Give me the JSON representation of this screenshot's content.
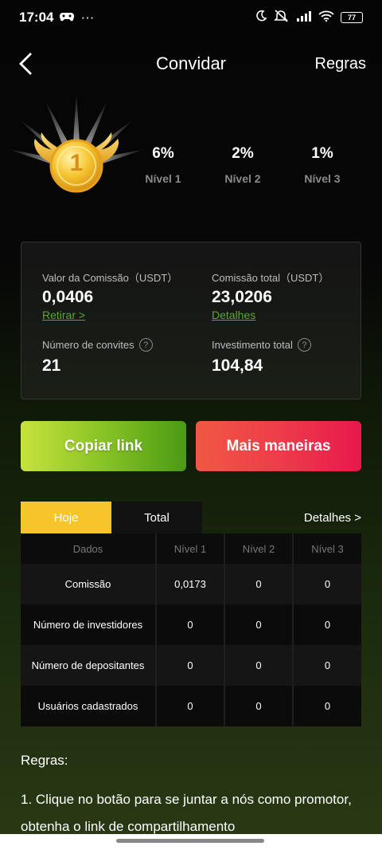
{
  "status_bar": {
    "time": "17:04",
    "dots": "···",
    "battery": "77"
  },
  "header": {
    "title": "Convidar",
    "rules_link": "Regras"
  },
  "medal": {
    "number": "1"
  },
  "levels": [
    {
      "pct": "6%",
      "name": "Nível 1"
    },
    {
      "pct": "2%",
      "name": "Nível 2"
    },
    {
      "pct": "1%",
      "name": "Nível 3"
    }
  ],
  "stats": {
    "commission_value": {
      "label": "Valor da Comissão（USDT）",
      "value": "0,0406",
      "link": "Retirar >"
    },
    "total_commission": {
      "label": "Comissão total（USDT）",
      "value": "23,0206",
      "link": "Detalhes"
    },
    "invites": {
      "label": "Número de convites",
      "value": "21"
    },
    "total_investment": {
      "label": "Investimento total",
      "value": "104,84"
    }
  },
  "buttons": {
    "copy": "Copiar link",
    "more": "Mais maneiras"
  },
  "tabs": {
    "today": "Hoje",
    "total": "Total",
    "details": "Detalhes >"
  },
  "table": {
    "headers": [
      "Dados",
      "Nível 1",
      "Nível 2",
      "Nível 3"
    ],
    "rows": [
      [
        "Comissão",
        "0,0173",
        "0",
        "0"
      ],
      [
        "Número de investidores",
        "0",
        "0",
        "0"
      ],
      [
        "Número de depositantes",
        "0",
        "0",
        "0"
      ],
      [
        "Usuários cadastrados",
        "0",
        "0",
        "0"
      ]
    ]
  },
  "rules": {
    "heading": "Regras:",
    "text": "1. Clique no botão para se juntar a nós como promotor, obtenha o link de compartilhamento"
  },
  "colors": {
    "accent_green": "#5aa832",
    "tab_active": "#f7c52a",
    "btn_red": "#ee3c4a"
  }
}
